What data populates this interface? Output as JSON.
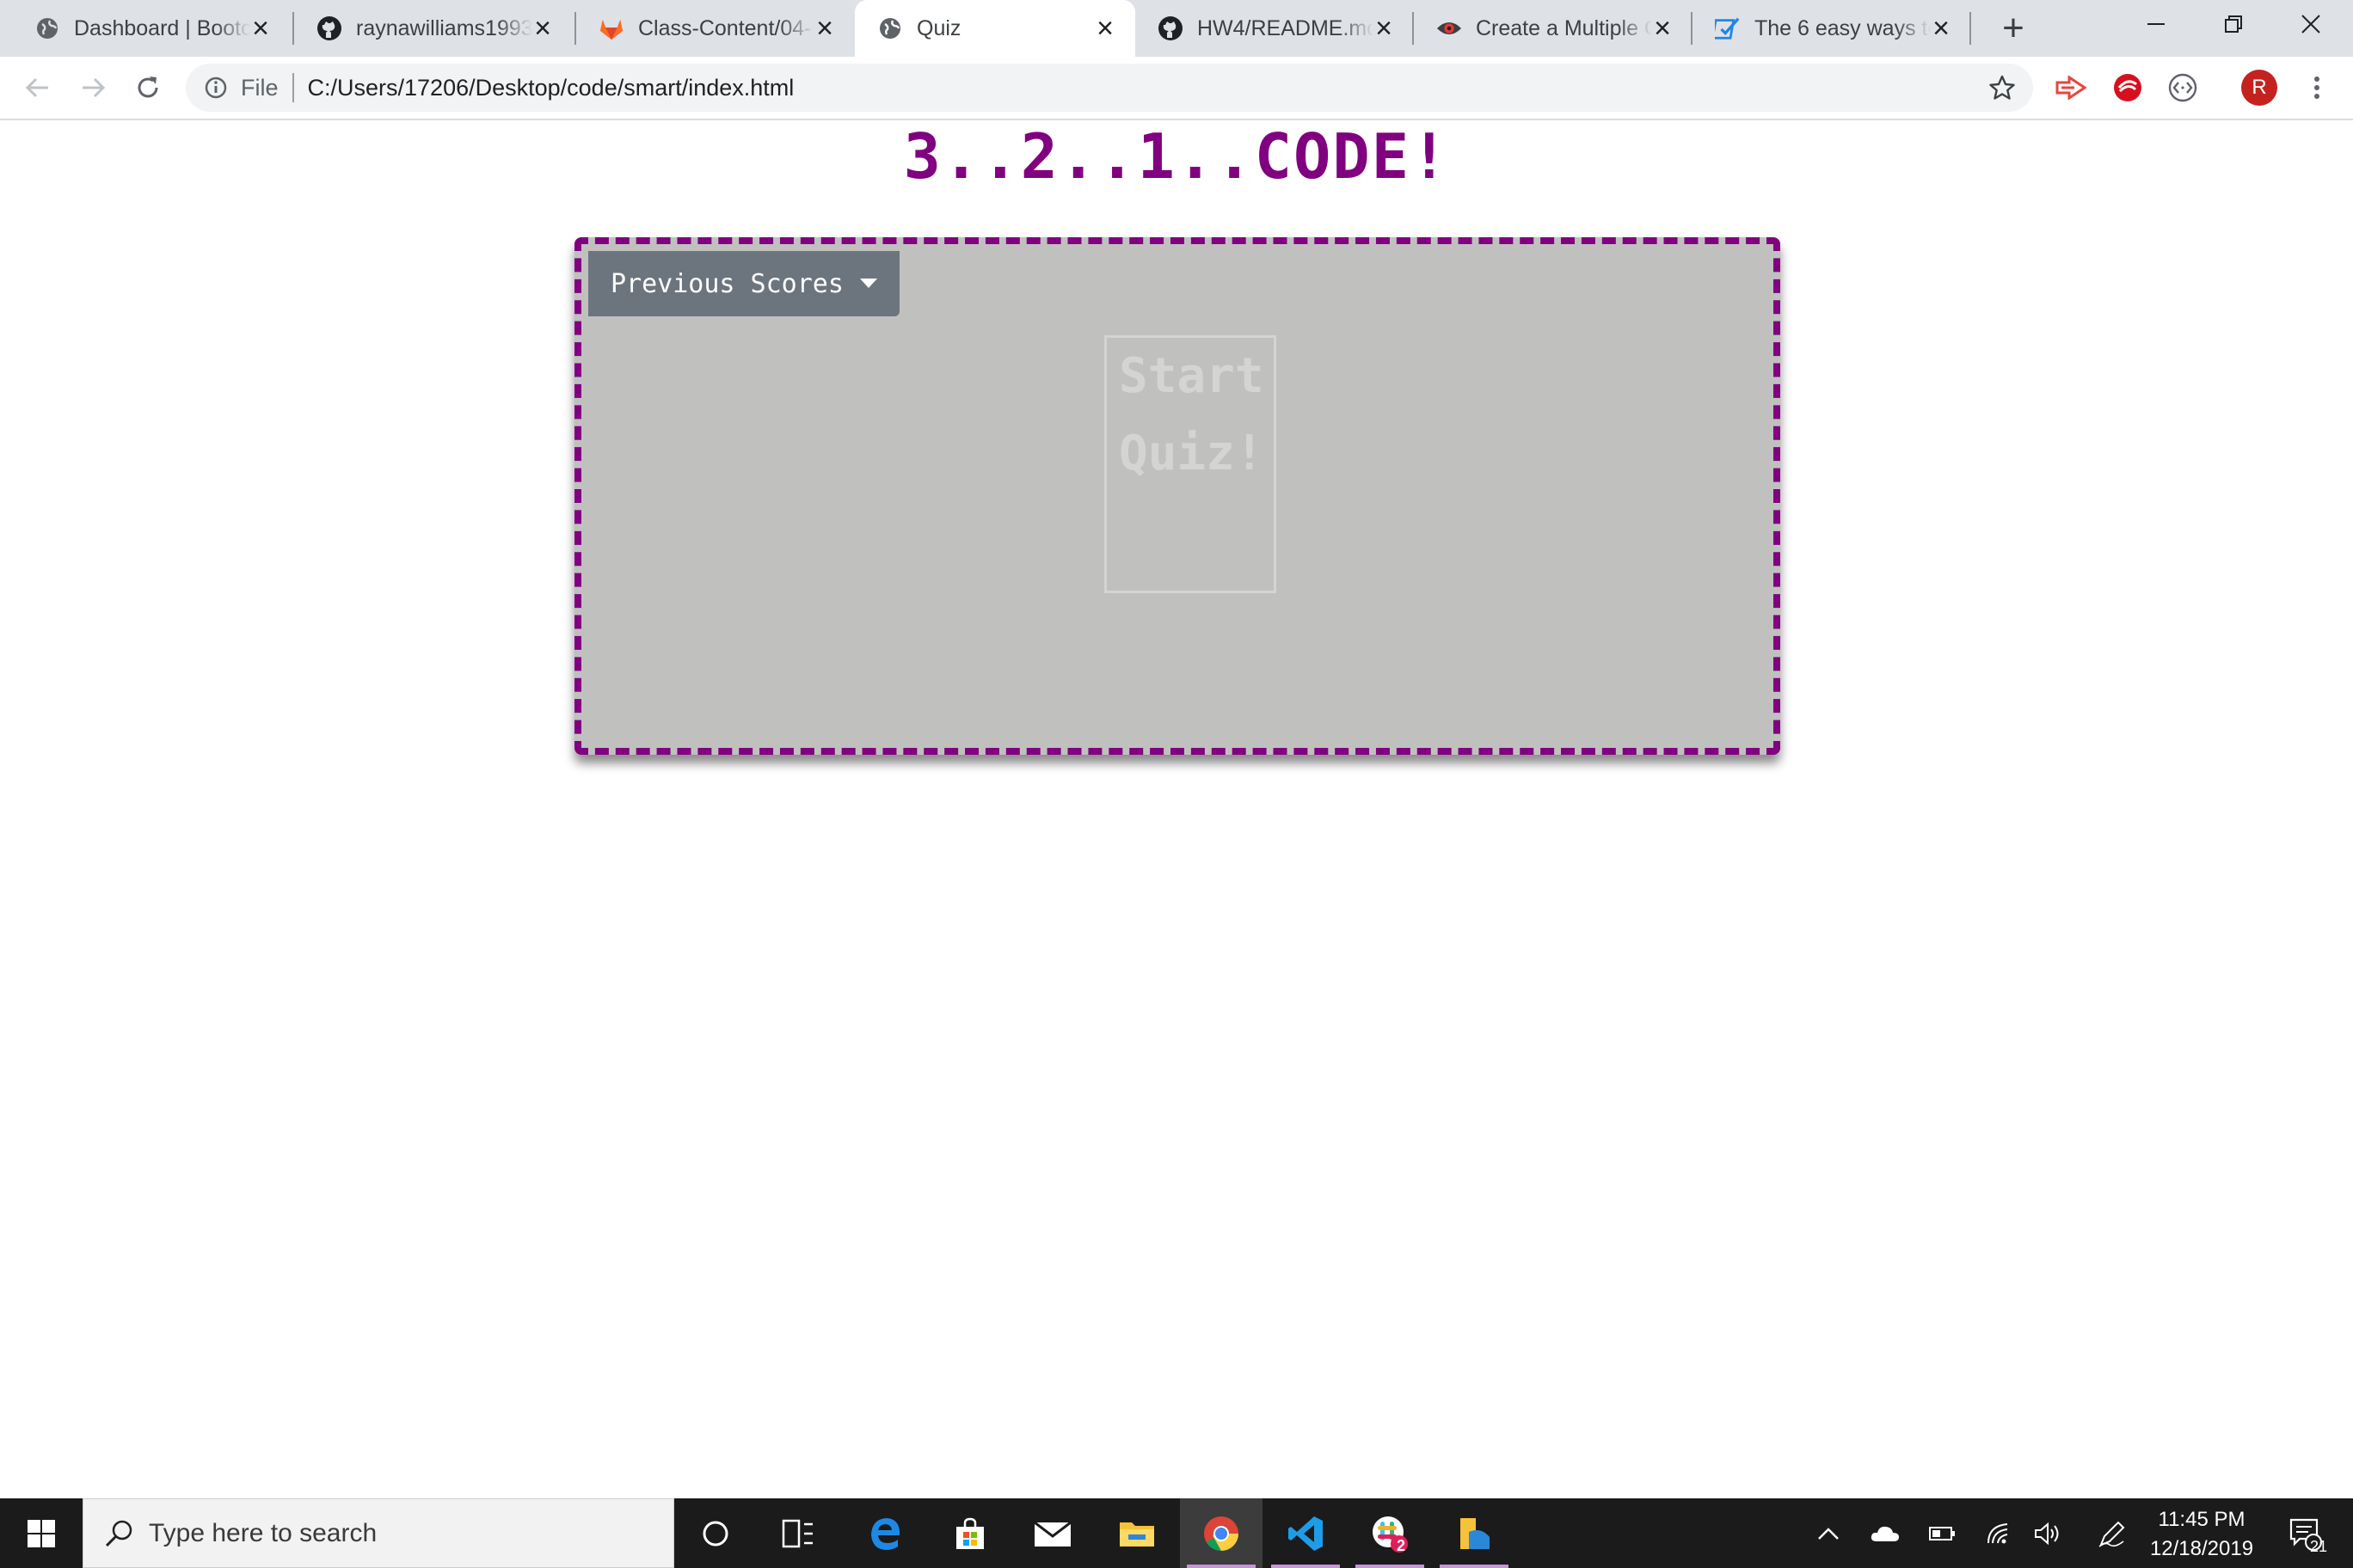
{
  "browser": {
    "tabs": [
      {
        "title": "Dashboard | Bootc",
        "favicon": "globe-icon",
        "active": false
      },
      {
        "title": "raynawilliams1993",
        "favicon": "github-icon",
        "active": false
      },
      {
        "title": "Class-Content/04-",
        "favicon": "gitlab-icon",
        "active": false
      },
      {
        "title": "Quiz",
        "favicon": "globe-icon",
        "active": true
      },
      {
        "title": "HW4/README.md",
        "favicon": "github-icon",
        "active": false
      },
      {
        "title": "Create a Multiple C",
        "favicon": "eye-icon",
        "active": false
      },
      {
        "title": "The 6 easy ways to",
        "favicon": "checkbox-icon",
        "active": false
      }
    ],
    "address": {
      "scheme": "File",
      "url": "C:/Users/17206/Desktop/code/smart/index.html"
    },
    "profile_initial": "R"
  },
  "page": {
    "title": "3..2..1..CODE!",
    "scores_dropdown_label": "Previous Scores",
    "start_button_label": "Start Quiz!"
  },
  "taskbar": {
    "search_placeholder": "Type here to search",
    "time": "11:45 PM",
    "date": "12/18/2019",
    "slack_badge": "2",
    "notification_count": "21"
  },
  "colors": {
    "accent_purple": "#800080",
    "quiz_background": "#c0c1bf",
    "dropdown_background": "#6c757d"
  }
}
